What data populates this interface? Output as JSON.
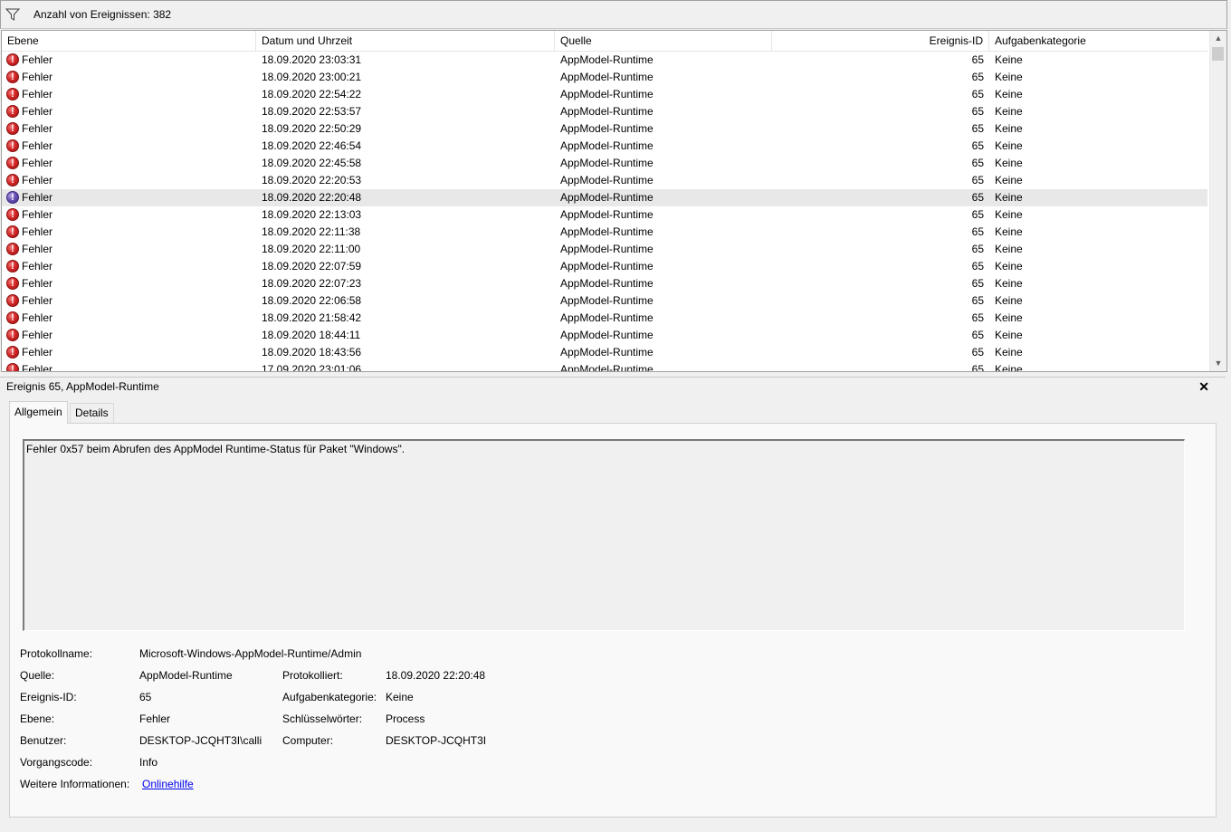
{
  "filter": {
    "icon": "filter-funnel-icon",
    "count_label": "Anzahl von Ereignissen: 382"
  },
  "columns": [
    "Ebene",
    "Datum und Uhrzeit",
    "Quelle",
    "Ereignis-ID",
    "Aufgabenkategorie"
  ],
  "events": [
    {
      "level": "Fehler",
      "date": "18.09.2020 23:03:31",
      "source": "AppModel-Runtime",
      "id": "65",
      "category": "Keine"
    },
    {
      "level": "Fehler",
      "date": "18.09.2020 23:00:21",
      "source": "AppModel-Runtime",
      "id": "65",
      "category": "Keine"
    },
    {
      "level": "Fehler",
      "date": "18.09.2020 22:54:22",
      "source": "AppModel-Runtime",
      "id": "65",
      "category": "Keine"
    },
    {
      "level": "Fehler",
      "date": "18.09.2020 22:53:57",
      "source": "AppModel-Runtime",
      "id": "65",
      "category": "Keine"
    },
    {
      "level": "Fehler",
      "date": "18.09.2020 22:50:29",
      "source": "AppModel-Runtime",
      "id": "65",
      "category": "Keine"
    },
    {
      "level": "Fehler",
      "date": "18.09.2020 22:46:54",
      "source": "AppModel-Runtime",
      "id": "65",
      "category": "Keine"
    },
    {
      "level": "Fehler",
      "date": "18.09.2020 22:45:58",
      "source": "AppModel-Runtime",
      "id": "65",
      "category": "Keine"
    },
    {
      "level": "Fehler",
      "date": "18.09.2020 22:20:53",
      "source": "AppModel-Runtime",
      "id": "65",
      "category": "Keine"
    },
    {
      "level": "Fehler",
      "date": "18.09.2020 22:20:48",
      "source": "AppModel-Runtime",
      "id": "65",
      "category": "Keine",
      "selected": true
    },
    {
      "level": "Fehler",
      "date": "18.09.2020 22:13:03",
      "source": "AppModel-Runtime",
      "id": "65",
      "category": "Keine"
    },
    {
      "level": "Fehler",
      "date": "18.09.2020 22:11:38",
      "source": "AppModel-Runtime",
      "id": "65",
      "category": "Keine"
    },
    {
      "level": "Fehler",
      "date": "18.09.2020 22:11:00",
      "source": "AppModel-Runtime",
      "id": "65",
      "category": "Keine"
    },
    {
      "level": "Fehler",
      "date": "18.09.2020 22:07:59",
      "source": "AppModel-Runtime",
      "id": "65",
      "category": "Keine"
    },
    {
      "level": "Fehler",
      "date": "18.09.2020 22:07:23",
      "source": "AppModel-Runtime",
      "id": "65",
      "category": "Keine"
    },
    {
      "level": "Fehler",
      "date": "18.09.2020 22:06:58",
      "source": "AppModel-Runtime",
      "id": "65",
      "category": "Keine"
    },
    {
      "level": "Fehler",
      "date": "18.09.2020 21:58:42",
      "source": "AppModel-Runtime",
      "id": "65",
      "category": "Keine"
    },
    {
      "level": "Fehler",
      "date": "18.09.2020 18:44:11",
      "source": "AppModel-Runtime",
      "id": "65",
      "category": "Keine"
    },
    {
      "level": "Fehler",
      "date": "18.09.2020 18:43:56",
      "source": "AppModel-Runtime",
      "id": "65",
      "category": "Keine"
    },
    {
      "level": "Fehler",
      "date": "17.09.2020 23:01:06",
      "source": "AppModel-Runtime",
      "id": "65",
      "category": "Keine"
    }
  ],
  "detail": {
    "title": "Ereignis 65, AppModel-Runtime",
    "close": "✕",
    "tabs": [
      "Allgemein",
      "Details"
    ],
    "message": "Fehler 0x57 beim Abrufen des AppModel Runtime-Status für Paket \"Windows\".",
    "props": {
      "protokollname_label": "Protokollname:",
      "protokollname": "Microsoft-Windows-AppModel-Runtime/Admin",
      "quelle_label": "Quelle:",
      "quelle": "AppModel-Runtime",
      "protokolliert_label": "Protokolliert:",
      "protokolliert": "18.09.2020 22:20:48",
      "ereignisid_label": "Ereignis-ID:",
      "ereignisid": "65",
      "aufgabenkategorie_label": "Aufgabenkategorie:",
      "aufgabenkategorie": "Keine",
      "ebene_label": "Ebene:",
      "ebene": "Fehler",
      "schluesselwoerter_label": "Schlüsselwörter:",
      "schluesselwoerter": "Process",
      "benutzer_label": "Benutzer:",
      "benutzer": "DESKTOP-JCQHT3I\\calli",
      "computer_label": "Computer:",
      "computer": "DESKTOP-JCQHT3I",
      "vorgangscode_label": "Vorgangscode:",
      "vorgangscode": "Info",
      "weitere_label": "Weitere Informationen:",
      "weitere_link": "Onlinehilfe"
    }
  }
}
